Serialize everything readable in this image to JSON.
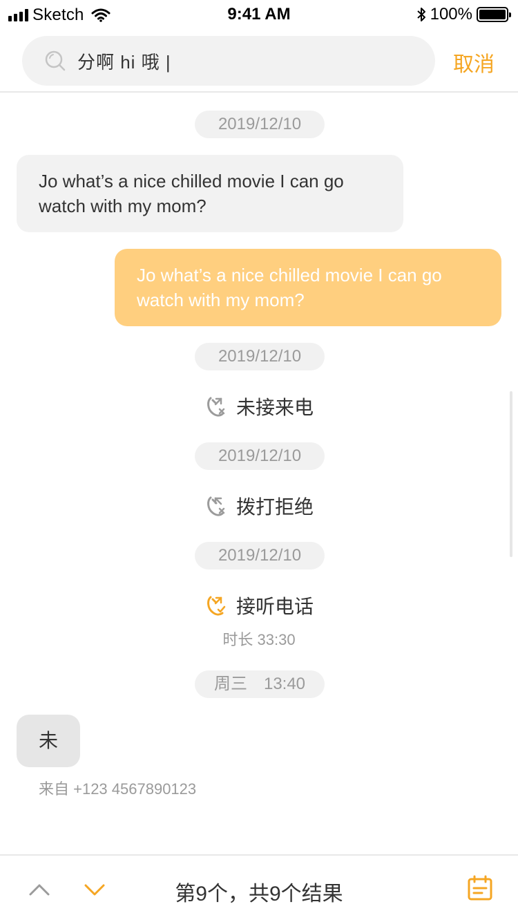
{
  "status_bar": {
    "carrier": "Sketch",
    "time": "9:41 AM",
    "battery": "100%"
  },
  "search": {
    "value": "分啊 hi 哦 |",
    "cancel_label": "取消"
  },
  "colors": {
    "accent": "#f5a623",
    "outgoing_bubble": "#ffcf7f",
    "incoming_bubble": "#f2f2f2",
    "pill": "#f1f1f1"
  },
  "messages": [
    {
      "date": "2019/12/10",
      "incoming_text": "Jo what’s a nice chilled movie I can go watch with my mom?",
      "outgoing_text": "Jo what’s a nice chilled movie I can go watch with my mom?"
    }
  ],
  "calls": [
    {
      "date": "2019/12/10",
      "icon": "missed-call-icon",
      "label": "未接来电"
    },
    {
      "date": "2019/12/10",
      "icon": "declined-call-icon",
      "label": "拨打拒绝"
    },
    {
      "date": "2019/12/10",
      "icon": "answered-call-icon",
      "label": "接听电话",
      "duration": "时长 33:30"
    }
  ],
  "last_message": {
    "date": "周三　13:40",
    "text": "未",
    "from": "来自 +123 4567890123"
  },
  "bottom_bar": {
    "result_text": "第9个，共9个结果"
  }
}
